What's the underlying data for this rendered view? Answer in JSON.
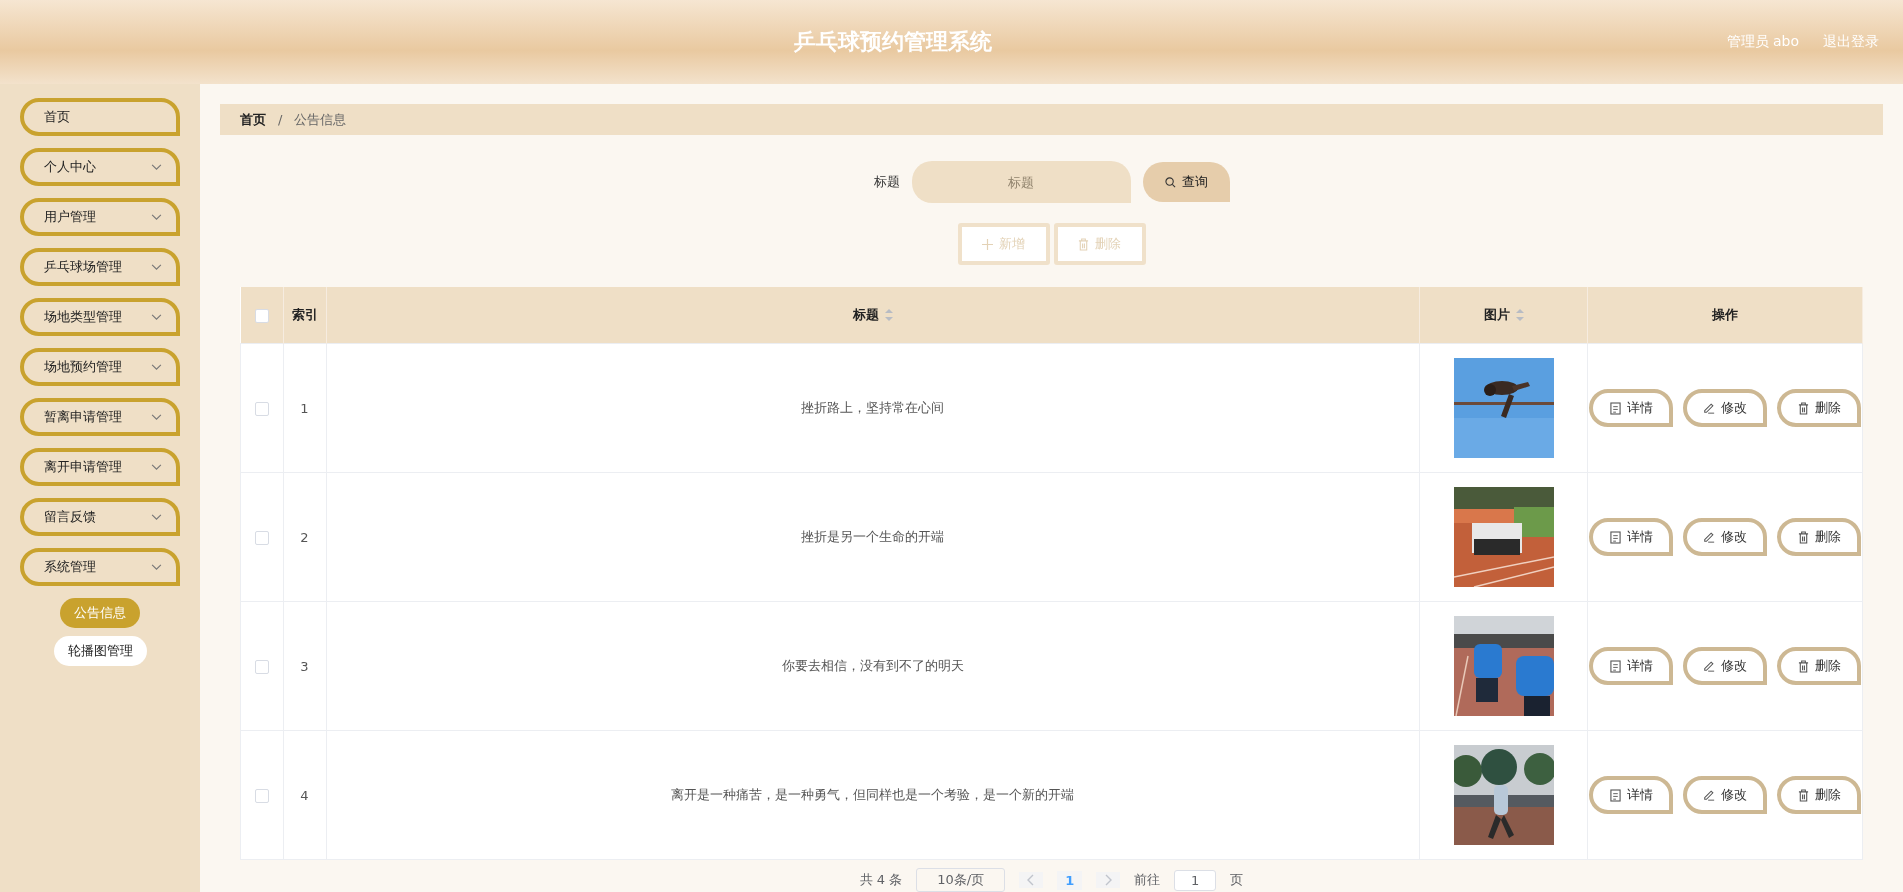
{
  "header": {
    "title": "乒乓球预约管理系统",
    "user": "管理员 abo",
    "logout": "退出登录"
  },
  "sidebar": {
    "items": [
      {
        "label": "首页",
        "kind": "link"
      },
      {
        "label": "个人中心",
        "kind": "menu"
      },
      {
        "label": "用户管理",
        "kind": "menu"
      },
      {
        "label": "乒乓球场管理",
        "kind": "menu"
      },
      {
        "label": "场地类型管理",
        "kind": "menu"
      },
      {
        "label": "场地预约管理",
        "kind": "menu"
      },
      {
        "label": "暂离申请管理",
        "kind": "menu"
      },
      {
        "label": "离开申请管理",
        "kind": "menu"
      },
      {
        "label": "留言反馈",
        "kind": "menu"
      },
      {
        "label": "系统管理",
        "kind": "menu",
        "children": [
          {
            "label": "公告信息",
            "selected": true
          },
          {
            "label": "轮播图管理",
            "selected": false
          }
        ]
      }
    ]
  },
  "breadcrumb": {
    "items": [
      "首页",
      "公告信息"
    ],
    "separator": "/"
  },
  "search": {
    "label": "标题",
    "placeholder": "标题",
    "button": "查询"
  },
  "actions": [
    {
      "kind": "add",
      "label": "新增"
    },
    {
      "kind": "delete",
      "label": "删除"
    }
  ],
  "table": {
    "select_all": {
      "checked": false
    },
    "columns": [
      {
        "label": "索引",
        "sortable": false
      },
      {
        "label": "标题",
        "sortable": true
      },
      {
        "label": "图片",
        "sortable": true
      },
      {
        "label": "操作",
        "sortable": false
      }
    ],
    "rows": [
      {
        "checked": false,
        "index": "1",
        "title": "挫折路上，坚持常在心间",
        "picture": {
          "kind": "picture"
        },
        "actions": [
          {
            "kind": "detail",
            "label": "详情"
          },
          {
            "kind": "edit",
            "label": "修改"
          },
          {
            "kind": "delete",
            "label": "删除"
          }
        ]
      },
      {
        "checked": false,
        "index": "2",
        "title": "挫折是另一个生命的开端",
        "picture": {
          "kind": "picture"
        },
        "actions": [
          {
            "kind": "detail",
            "label": "详情"
          },
          {
            "kind": "edit",
            "label": "修改"
          },
          {
            "kind": "delete",
            "label": "删除"
          }
        ]
      },
      {
        "checked": false,
        "index": "3",
        "title": "你要去相信，没有到不了的明天",
        "picture": {
          "kind": "picture"
        },
        "actions": [
          {
            "kind": "detail",
            "label": "详情"
          },
          {
            "kind": "edit",
            "label": "修改"
          },
          {
            "kind": "delete",
            "label": "删除"
          }
        ]
      },
      {
        "checked": false,
        "index": "4",
        "title": "离开是一种痛苦，是一种勇气，但同样也是一个考验，是一个新的开端",
        "picture": {
          "kind": "picture"
        },
        "actions": [
          {
            "kind": "detail",
            "label": "详情"
          },
          {
            "kind": "edit",
            "label": "修改"
          },
          {
            "kind": "delete",
            "label": "删除"
          }
        ]
      }
    ]
  },
  "pagination": {
    "total": "共 4 条",
    "page_size": "10条/页",
    "pages": [
      {
        "label": "1",
        "selected": true
      }
    ],
    "goto_label": "前往",
    "goto_value": "1",
    "goto_suffix": "页"
  }
}
